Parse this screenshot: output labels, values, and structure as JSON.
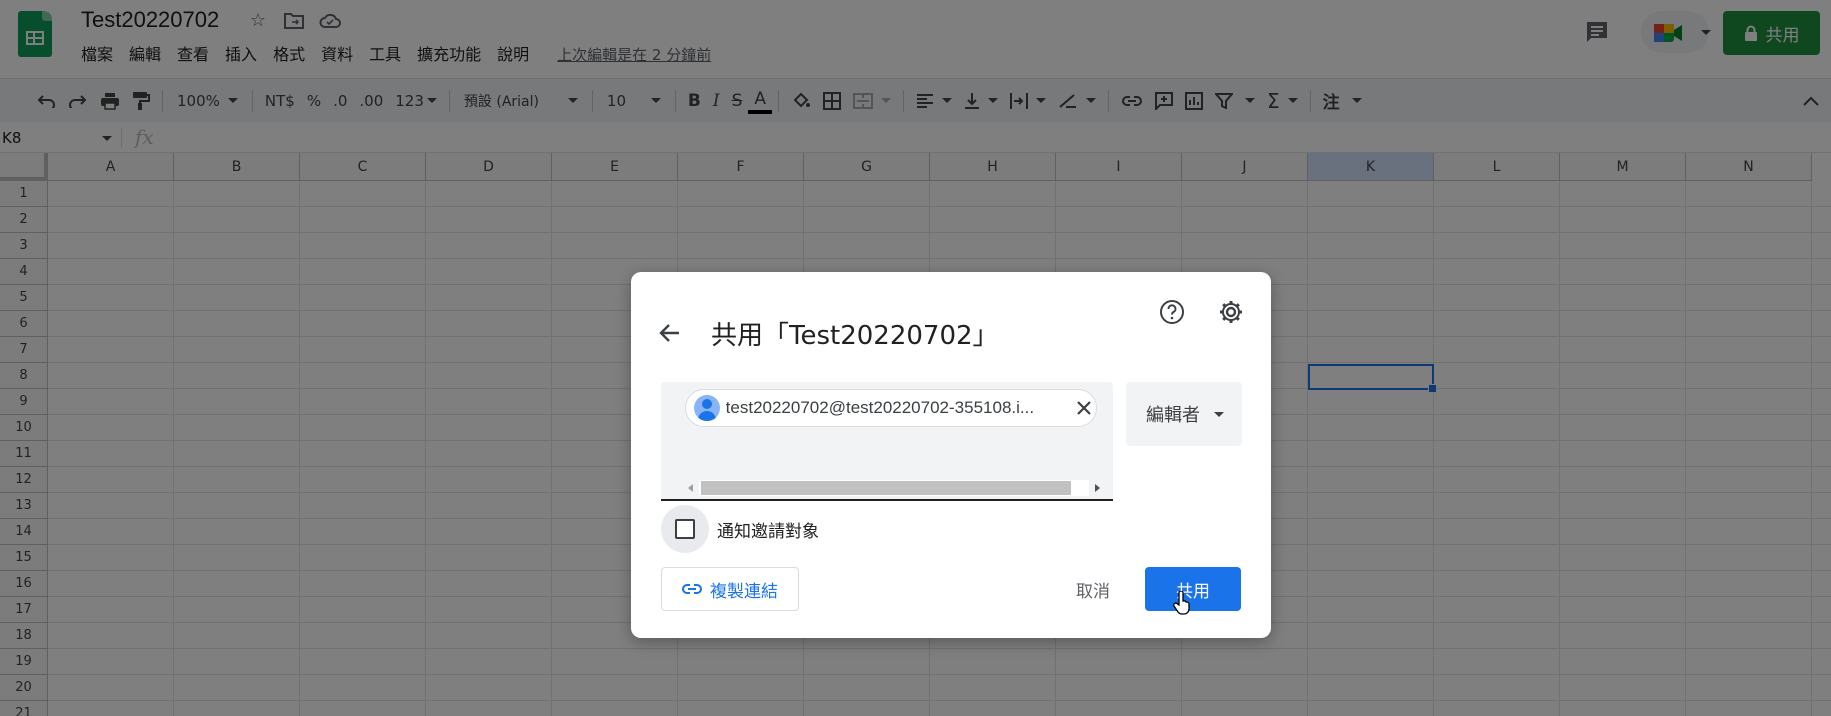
{
  "app": {
    "doc_title": "Test20220702",
    "menu": [
      "檔案",
      "編輯",
      "查看",
      "插入",
      "格式",
      "資料",
      "工具",
      "擴充功能",
      "說明"
    ],
    "last_edit": "上次編輯是在 2 分鐘前",
    "share_label": "共用"
  },
  "toolbar": {
    "zoom": "100%",
    "currency": "NT$",
    "percent": "%",
    "dec_decrease": ".0",
    "dec_increase": ".00",
    "more_formats": "123",
    "font": "預設 (Arial)",
    "font_size": "10"
  },
  "formula_bar": {
    "name_box": "K8",
    "fx": "fx"
  },
  "sheet": {
    "columns": [
      "A",
      "B",
      "C",
      "D",
      "E",
      "F",
      "G",
      "H",
      "I",
      "J",
      "K",
      "L",
      "M",
      "N"
    ],
    "rows": [
      "1",
      "2",
      "3",
      "4",
      "5",
      "6",
      "7",
      "8",
      "9",
      "10",
      "11",
      "12",
      "13",
      "14",
      "15",
      "16",
      "17",
      "18",
      "19",
      "20",
      "21"
    ],
    "selected_column": "K"
  },
  "dialog": {
    "title": "共用「Test20220702」",
    "recipient": "test20220702@test20220702-355108.i...",
    "role": "編輯者",
    "notify_label": "通知邀請對象",
    "copy_link": "複製連結",
    "cancel": "取消",
    "share": "共用"
  },
  "colors": {
    "accent": "#1a73e8",
    "share_green": "#1e8e3e"
  }
}
